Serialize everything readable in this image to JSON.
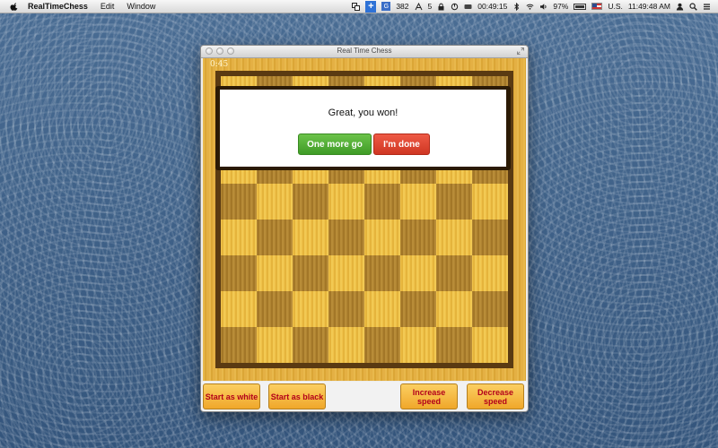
{
  "menubar": {
    "app_name": "RealTimeChess",
    "menus": [
      "Edit",
      "Window"
    ],
    "status": {
      "icon_count": "382",
      "adobe_count": "5",
      "clock_timer": "00:49:15",
      "battery": "97%",
      "input_source": "U.S.",
      "time": "11:49:48 AM"
    }
  },
  "window": {
    "title": "Real Time Chess",
    "timer": "0:45"
  },
  "dialog": {
    "message": "Great, you won!",
    "primary_label": "One more go",
    "secondary_label": "I'm done"
  },
  "controls": {
    "start_white": "Start as white",
    "start_black": "Start as black",
    "increase_speed": "Increase speed",
    "decrease_speed": "Decrease speed"
  },
  "colors": {
    "board_light": "#f0c24a",
    "board_dark": "#b08432",
    "button_text": "#b3001b",
    "dialog_green": "#4aaa2e",
    "dialog_red": "#d93c28"
  }
}
